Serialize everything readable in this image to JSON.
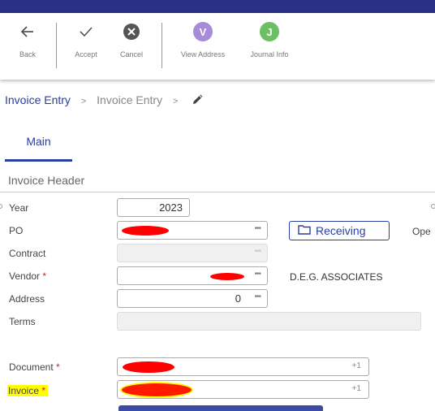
{
  "toolbar": {
    "back_label": "Back",
    "accept_label": "Accept",
    "cancel_label": "Cancel",
    "view_address_label": "View Address",
    "view_address_letter": "V",
    "journal_info_label": "Journal Info",
    "journal_info_letter": "J",
    "colors": {
      "topstrip": "#2b2f86",
      "view_address": "#a58bd8",
      "journal_info": "#6cbf63",
      "cancel": "#555555"
    }
  },
  "breadcrumb": {
    "items": [
      "Invoice Entry",
      "Invoice Entry"
    ],
    "separator": ">"
  },
  "tabs": [
    {
      "label": "Main",
      "active": true
    }
  ],
  "section": {
    "title": "Invoice Header"
  },
  "form": {
    "year": {
      "label": "Year",
      "value": "2023"
    },
    "po": {
      "label": "PO",
      "value": ""
    },
    "contract": {
      "label": "Contract",
      "value": ""
    },
    "vendor": {
      "label": "Vendor",
      "required_mark": "*",
      "value": "",
      "name": "D.E.G. ASSOCIATES"
    },
    "address": {
      "label": "Address",
      "value": "0"
    },
    "terms": {
      "label": "Terms",
      "value": ""
    },
    "document": {
      "label": "Document",
      "required_mark": "*",
      "value": ""
    },
    "invoice": {
      "label": "Invoice",
      "required_mark": "*",
      "value": ""
    }
  },
  "receiving_button": {
    "label": "Receiving"
  },
  "truncated_label": "Ope"
}
